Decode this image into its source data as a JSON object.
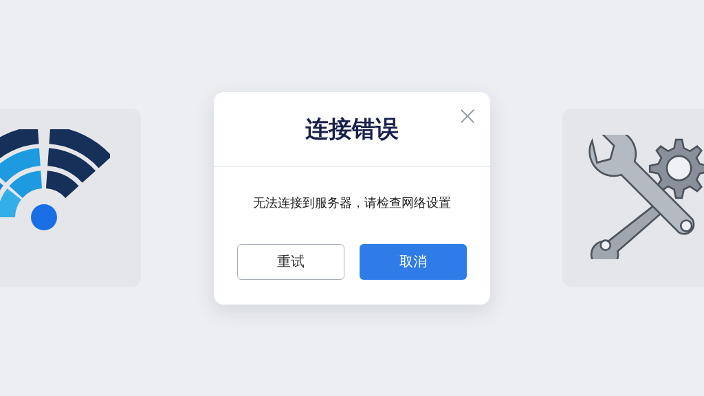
{
  "dialog": {
    "title": "连接错误",
    "message": "无法连接到服务器，请检查网络设置",
    "buttons": [
      {
        "label": "重试",
        "kind": "secondary"
      },
      {
        "label": "取消",
        "kind": "primary"
      }
    ]
  }
}
